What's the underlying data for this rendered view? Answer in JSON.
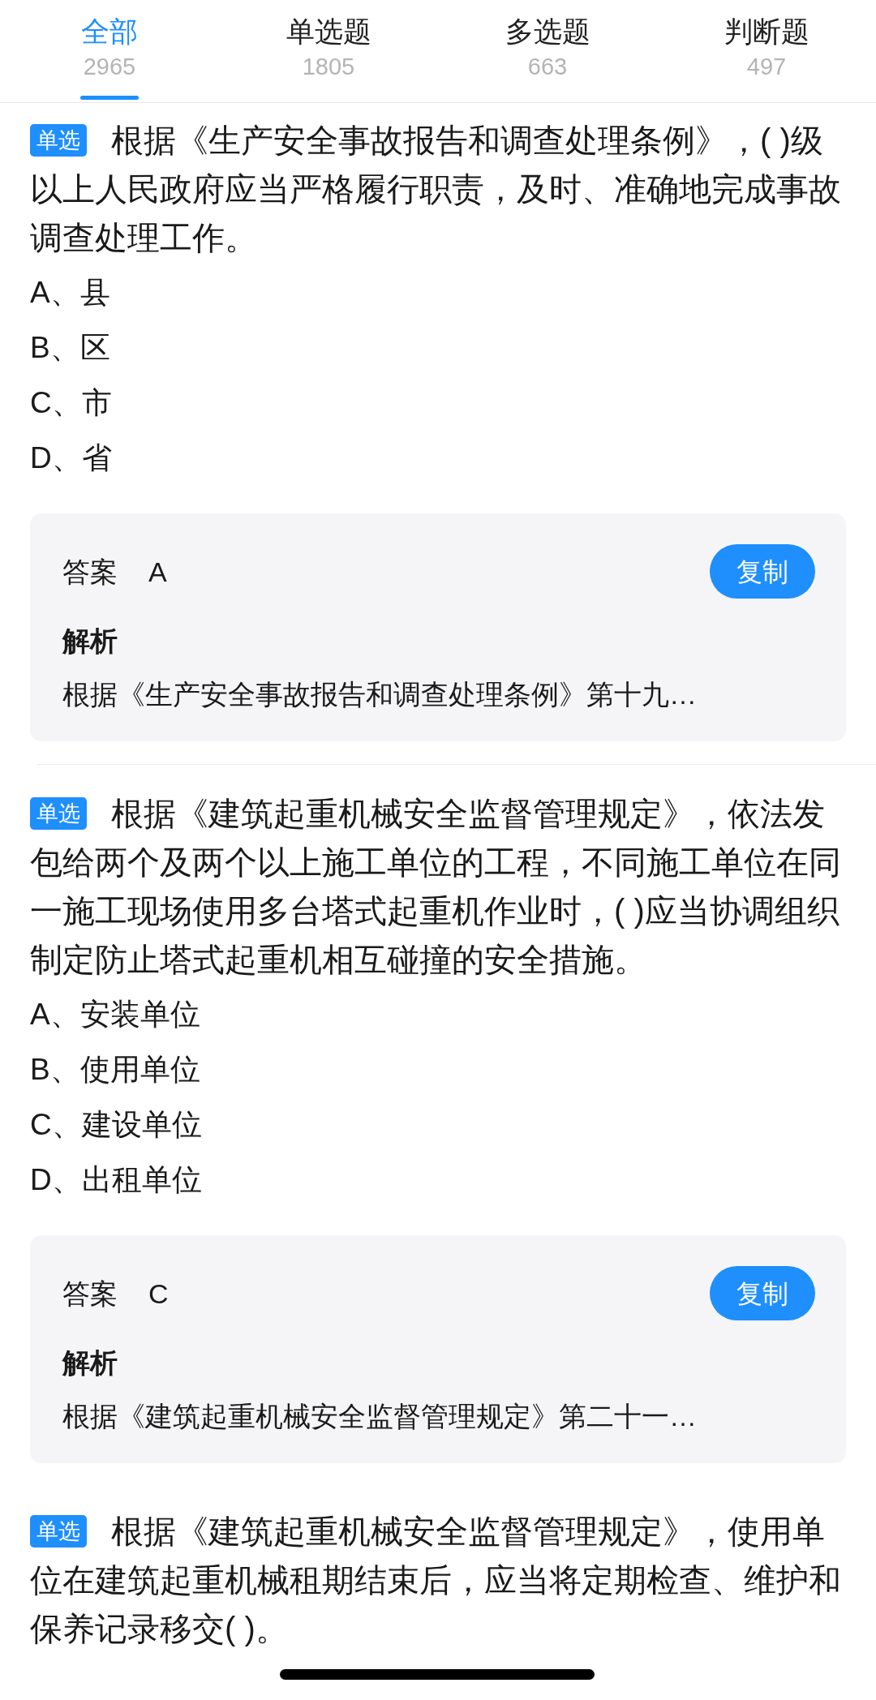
{
  "tabs": [
    {
      "label": "全部",
      "count": "2965",
      "selected": true
    },
    {
      "label": "单选题",
      "count": "1805",
      "selected": false
    },
    {
      "label": "多选题",
      "count": "663",
      "selected": false
    },
    {
      "label": "判断题",
      "count": "497",
      "selected": false
    }
  ],
  "questions": [
    {
      "tag": "单选",
      "text": "根据《生产安全事故报告和调查处理条例》，( )级以上人民政府应当严格履行职责，及时、准确地完成事故调查处理工作。",
      "options": [
        "A、县",
        "B、区",
        "C、市",
        "D、省"
      ],
      "answer": {
        "label": "答案",
        "value": "A",
        "copy_button": "复制",
        "analysis_label": "解析",
        "analysis": "根据《生产安全事故报告和调查处理条例》第十九…"
      }
    },
    {
      "tag": "单选",
      "text": "根据《建筑起重机械安全监督管理规定》，依法发包给两个及两个以上施工单位的工程，不同施工单位在同一施工现场使用多台塔式起重机作业时，( )应当协调组织制定防止塔式起重机相互碰撞的安全措施。",
      "options": [
        "A、安装单位",
        "B、使用单位",
        "C、建设单位",
        "D、出租单位"
      ],
      "answer": {
        "label": "答案",
        "value": "C",
        "copy_button": "复制",
        "analysis_label": "解析",
        "analysis": "根据《建筑起重机械安全监督管理规定》第二十一…"
      }
    },
    {
      "tag": "单选",
      "text": "根据《建筑起重机械安全监督管理规定》，使用单位在建筑起重机械租期结束后，应当将定期检查、维护和保养记录移交( )。"
    }
  ]
}
